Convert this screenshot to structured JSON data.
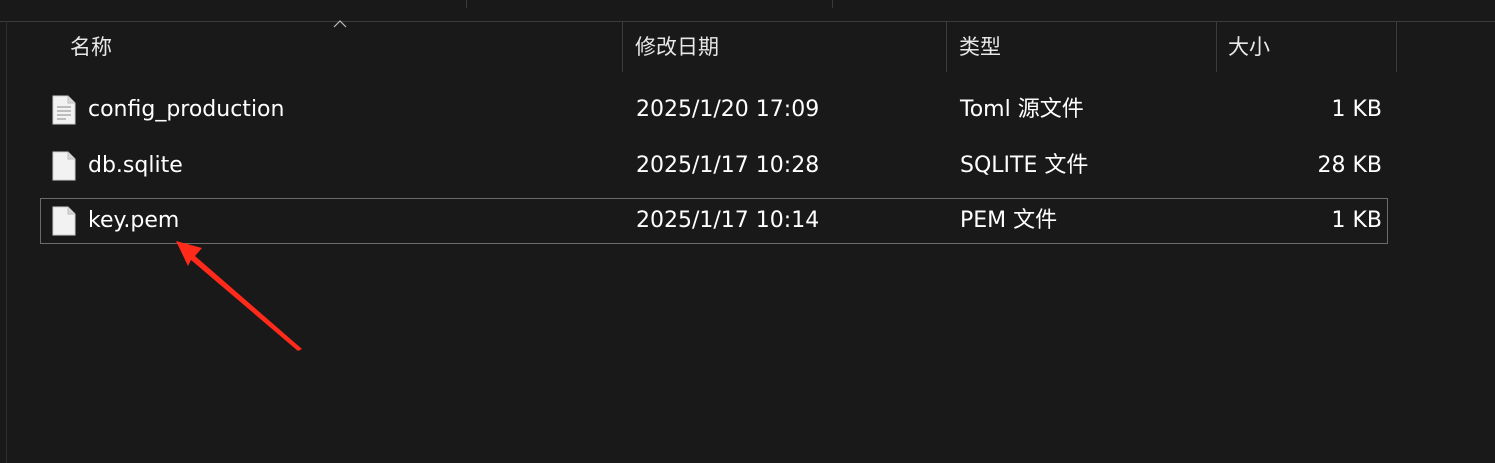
{
  "columns": {
    "name": "名称",
    "modified": "修改日期",
    "type": "类型",
    "size": "大小"
  },
  "files": [
    {
      "name": "config_production",
      "modified": "2025/1/20 17:09",
      "type": "Toml 源文件",
      "size": "1 KB",
      "icon": "text-document-icon"
    },
    {
      "name": "db.sqlite",
      "modified": "2025/1/17 10:28",
      "type": "SQLITE 文件",
      "size": "28 KB",
      "icon": "blank-document-icon"
    },
    {
      "name": "key.pem",
      "modified": "2025/1/17 10:14",
      "type": "PEM 文件",
      "size": "1 KB",
      "icon": "blank-document-icon",
      "focused": true
    }
  ],
  "annotation": {
    "type": "red-arrow",
    "color": "#ff2a1a",
    "points_to": "key.pem"
  },
  "colors": {
    "background": "#191919",
    "text": "#ffffff",
    "separator": "#3c3c3c",
    "focus_border": "#6b6b6b"
  }
}
